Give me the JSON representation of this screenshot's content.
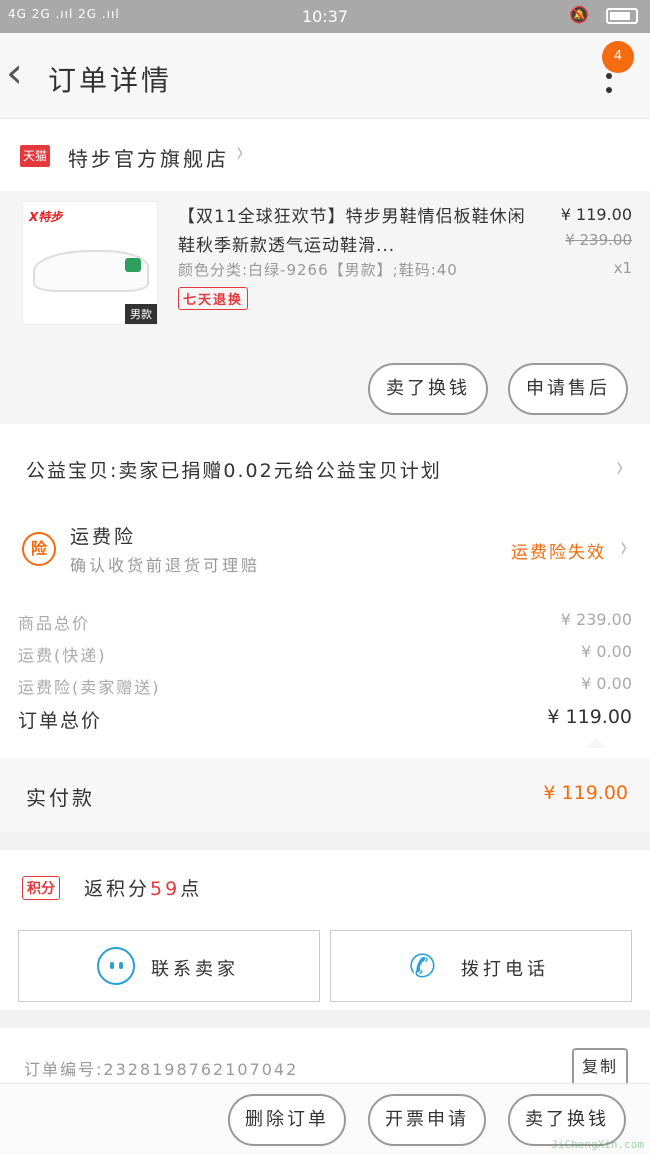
{
  "status_bar": {
    "signal": "4G 2G .ııl 2G .ııl",
    "time": "10:37"
  },
  "header": {
    "back_icon": "chevron-left-icon",
    "title": "订单详情",
    "badge_count": "4",
    "more_icon": "more-vertical-icon"
  },
  "shop": {
    "tag": "天猫",
    "name": "特步官方旗舰店"
  },
  "product": {
    "brand": "X特步",
    "gender_tag": "男款",
    "title": "【双11全球狂欢节】特步男鞋情侣板鞋休闲鞋秋季新款透气运动鞋滑...",
    "sku": "颜色分类:白绿-9266【男款】;鞋码:40",
    "service_tag": "七天退换",
    "price": "¥ 119.00",
    "original_price": "¥ 239.00",
    "quantity": "x1",
    "buttons": [
      "卖了换钱",
      "申请售后"
    ]
  },
  "charity": {
    "text": "公益宝贝:卖家已捐赠0.02元给公益宝贝计划"
  },
  "insurance": {
    "icon_text": "险",
    "title": "运费险",
    "subtitle": "确认收货前退货可理赔",
    "status": "运费险失效"
  },
  "summary": {
    "rows": [
      {
        "label": "商品总价",
        "value": "¥ 239.00"
      },
      {
        "label": "运费(快递)",
        "value": "¥ 0.00"
      },
      {
        "label": "运费险(卖家赠送)",
        "value": "¥ 0.00"
      }
    ],
    "total_label": "订单总价",
    "total_value": "¥ 119.00"
  },
  "paid": {
    "label": "实付款",
    "value": "¥ 119.00"
  },
  "points": {
    "tag": "积分",
    "text_prefix": "返积分",
    "amount": "59",
    "text_suffix": "点"
  },
  "contact": {
    "seller_label": "联系卖家",
    "call_label": "拨打电话"
  },
  "order": {
    "number_text": "订单编号:2328198762107042",
    "copy_label": "复制"
  },
  "bottom_bar": {
    "buttons": [
      "删除订单",
      "开票申请",
      "卖了换钱"
    ]
  },
  "watermark": "JiChengXin.com",
  "colors": {
    "accent": "#f46c0f",
    "tmall_red": "#e4393c",
    "icon_blue": "#2a9fd6",
    "status_bar": "#a9a9a9"
  }
}
